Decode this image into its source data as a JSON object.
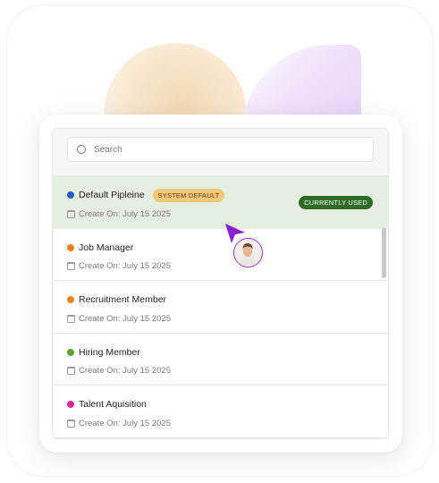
{
  "search": {
    "placeholder": "Search"
  },
  "pipelines": [
    {
      "name": "Default Pipleine",
      "dot_color": "#1f5fbf",
      "badge": "SYSTEM DEFAULT",
      "date_label": "Create On: July 15 2025",
      "status": "CURRENTLY USED",
      "selected": true
    },
    {
      "name": "Job Manager",
      "dot_color": "#f07f1e",
      "date_label": "Create On: July 15 2025",
      "selected": false
    },
    {
      "name": "Recruitment Member",
      "dot_color": "#f07f1e",
      "date_label": "Create On: July 15 2025",
      "selected": false
    },
    {
      "name": "Hiring Member",
      "dot_color": "#5aa335",
      "date_label": "Create On: July 15 2025",
      "selected": false
    },
    {
      "name": "Talent Aquisition",
      "dot_color": "#e0288f",
      "date_label": "Create On: July 15 2025",
      "selected": false
    }
  ],
  "colors": {
    "cursor": "#8b1fd6",
    "selected_row": "#e6eee2",
    "current_badge": "#2e6b24",
    "default_badge": "#f0c77b"
  },
  "icons": {
    "search": "search-icon",
    "calendar": "calendar-icon",
    "cursor": "cursor-arrow-icon"
  }
}
